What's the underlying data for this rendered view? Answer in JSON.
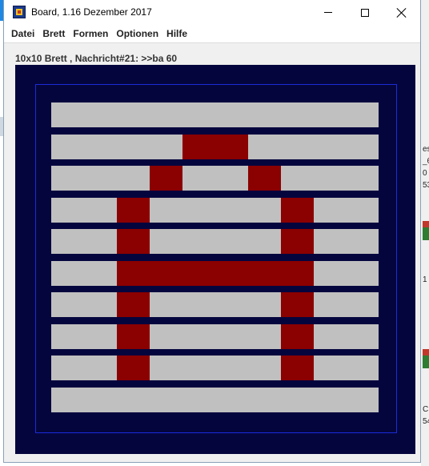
{
  "window": {
    "title": "Board, 1.16 Dezember 2017"
  },
  "menu": [
    "Datei",
    "Brett",
    "Formen",
    "Optionen",
    "Hilfe"
  ],
  "status_text": "10x10 Brett , Nachricht#21: >>ba 60",
  "board": {
    "rows": 10,
    "cols": 10,
    "colors": {
      "background": "#05053e",
      "frame": "#1a2cd8",
      "cell_off": "#c0c0c0",
      "cell_on": "#8b0000"
    },
    "cells": [
      [
        0,
        0,
        0,
        0,
        0,
        0,
        0,
        0,
        0,
        0
      ],
      [
        0,
        0,
        0,
        0,
        1,
        1,
        0,
        0,
        0,
        0
      ],
      [
        0,
        0,
        0,
        1,
        0,
        0,
        1,
        0,
        0,
        0
      ],
      [
        0,
        0,
        1,
        0,
        0,
        0,
        0,
        1,
        0,
        0
      ],
      [
        0,
        0,
        1,
        0,
        0,
        0,
        0,
        1,
        0,
        0
      ],
      [
        0,
        0,
        1,
        1,
        1,
        1,
        1,
        1,
        0,
        0
      ],
      [
        0,
        0,
        1,
        0,
        0,
        0,
        0,
        1,
        0,
        0
      ],
      [
        0,
        0,
        1,
        0,
        0,
        0,
        0,
        1,
        0,
        0
      ],
      [
        0,
        0,
        1,
        0,
        0,
        0,
        0,
        1,
        0,
        0
      ],
      [
        0,
        0,
        0,
        0,
        0,
        0,
        0,
        0,
        0,
        0
      ]
    ]
  },
  "background_fragments": [
    "es",
    "_6",
    "0",
    "53",
    "1",
    "C",
    "54"
  ]
}
